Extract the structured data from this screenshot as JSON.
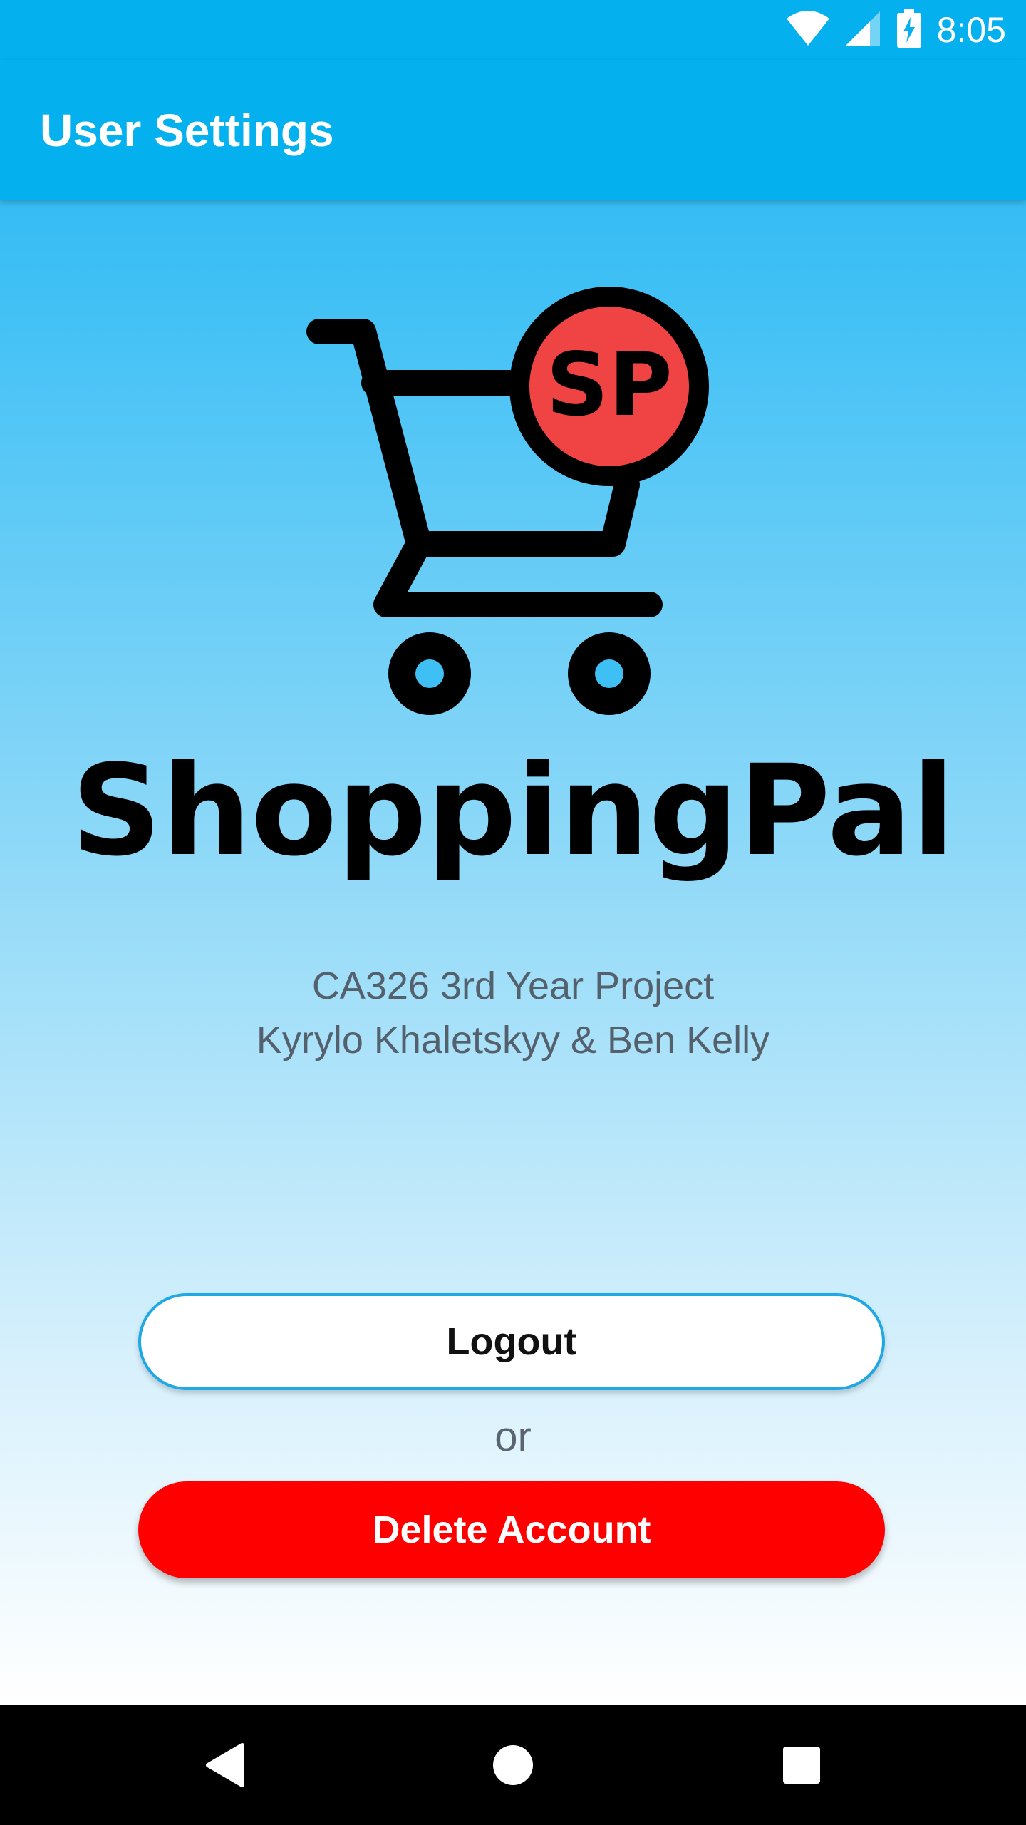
{
  "status_bar": {
    "time": "8:05",
    "icons": [
      "wifi-icon",
      "cellular-signal-icon",
      "battery-charging-icon"
    ]
  },
  "app_bar": {
    "title": "User Settings"
  },
  "logo": {
    "badge_text": "SP",
    "wordmark": "ShoppingPal",
    "icon": "shopping-cart-icon"
  },
  "credits": {
    "line1": "CA326 3rd Year Project",
    "line2": "Kyrylo Khaletskyy & Ben Kelly"
  },
  "actions": {
    "logout_label": "Logout",
    "separator": "or",
    "delete_label": "Delete Account"
  },
  "nav_bar": {
    "buttons": [
      "back-icon",
      "home-icon",
      "recents-icon"
    ]
  },
  "colors": {
    "primary": "#05b0ef",
    "danger": "#ff0000",
    "badge": "#f04444",
    "text_muted": "#54606b"
  }
}
